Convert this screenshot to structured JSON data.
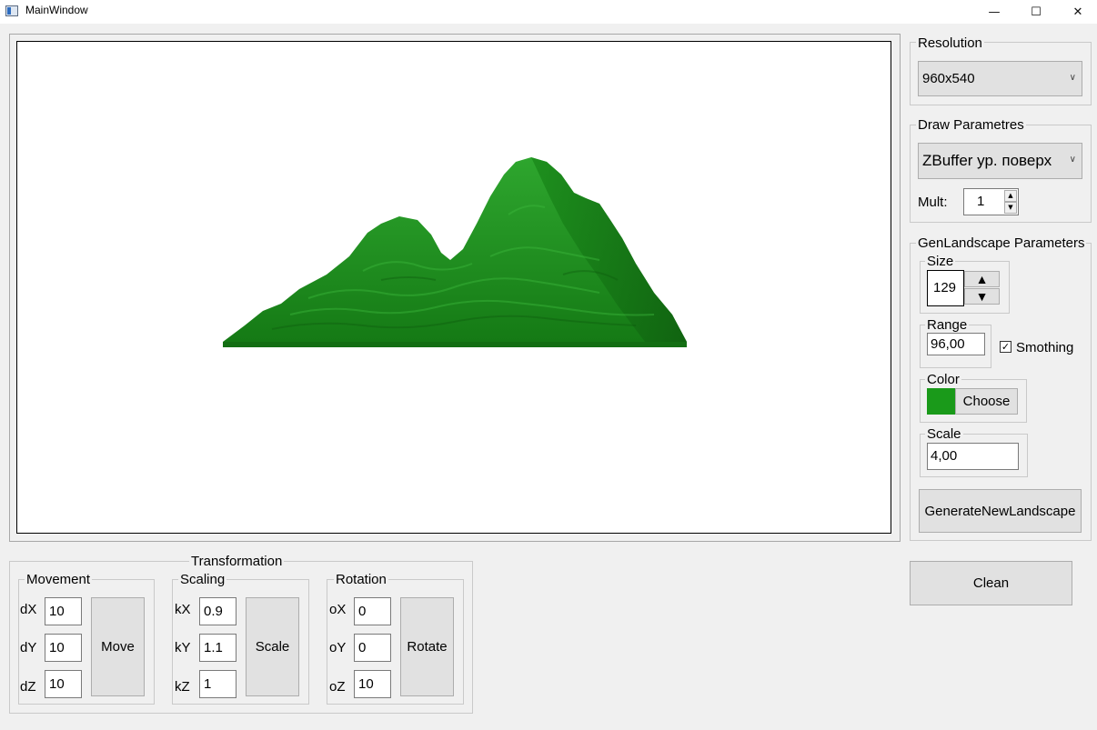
{
  "window": {
    "title": "MainWindow",
    "minimize_glyph": "—",
    "maximize_glyph": "☐",
    "close_glyph": "✕"
  },
  "colors": {
    "terrain": "#1f8c1f",
    "color_swatch": "#1a9a1a"
  },
  "resolution": {
    "legend": "Resolution",
    "selected": "960x540"
  },
  "draw_params": {
    "legend": "Draw Parametres",
    "selected": "ZBuffer ур. поверх",
    "mult_label": "Mult:",
    "mult_value": "1"
  },
  "gen": {
    "legend": "GenLandscape Parameters",
    "size_label": "Size",
    "size_value": "129",
    "range_label": "Range",
    "range_value": "96,00",
    "smoothing_label": "Smothing",
    "smoothing_checked": true,
    "color_label": "Color",
    "choose_label": "Choose",
    "scale_label": "Scale",
    "scale_value": "4,00",
    "generate_label": "GenerateNewLandscape"
  },
  "clean_label": "Clean",
  "transformation": {
    "legend": "Transformation",
    "movement": {
      "legend": "Movement",
      "labels": [
        "dX",
        "dY",
        "dZ"
      ],
      "values": [
        "10",
        "10",
        "10"
      ],
      "button": "Move"
    },
    "scaling": {
      "legend": "Scaling",
      "labels": [
        "kX",
        "kY",
        "kZ"
      ],
      "values": [
        "0.9",
        "1.1",
        "1"
      ],
      "button": "Scale"
    },
    "rotation": {
      "legend": "Rotation",
      "labels": [
        "oX",
        "oY",
        "oZ"
      ],
      "values": [
        "0",
        "0",
        "10"
      ],
      "button": "Rotate"
    }
  }
}
